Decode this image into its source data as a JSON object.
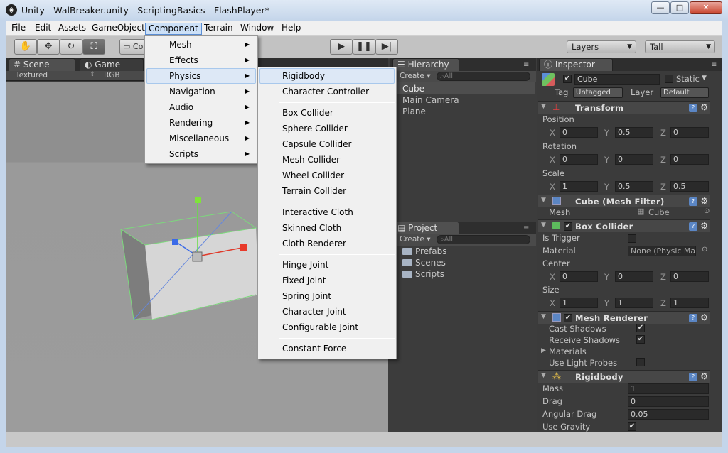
{
  "window": {
    "title": "Unity - WalBreaker.unity - ScriptingBasics - FlashPlayer*",
    "min": "—",
    "max": "□",
    "close": "✕"
  },
  "menubar": [
    "File",
    "Edit",
    "Assets",
    "GameObject",
    "Component",
    "Terrain",
    "Window",
    "Help"
  ],
  "toolbar": {
    "co_label": "Co",
    "layers": "Layers",
    "layout": "Tall"
  },
  "scene": {
    "tab_scene": "Scene",
    "tab_game": "Game",
    "shading": "Textured",
    "rgb": "RGB"
  },
  "component_menu": {
    "items": [
      "Mesh",
      "Effects",
      "Physics",
      "Navigation",
      "Audio",
      "Rendering",
      "Miscellaneous",
      "Scripts"
    ],
    "highlighted": "Physics"
  },
  "physics_menu": {
    "groups": [
      [
        "Rigidbody",
        "Character Controller"
      ],
      [
        "Box Collider",
        "Sphere Collider",
        "Capsule Collider",
        "Mesh Collider",
        "Wheel Collider",
        "Terrain Collider"
      ],
      [
        "Interactive Cloth",
        "Skinned Cloth",
        "Cloth Renderer"
      ],
      [
        "Hinge Joint",
        "Fixed Joint",
        "Spring Joint",
        "Character Joint",
        "Configurable Joint"
      ],
      [
        "Constant Force"
      ]
    ],
    "highlighted": "Rigidbody"
  },
  "hierarchy": {
    "tab": "Hierarchy",
    "create": "Create ▾",
    "search": "All",
    "items": [
      "Cube",
      "Main Camera",
      "Plane"
    ]
  },
  "project": {
    "tab": "Project",
    "create": "Create ▾",
    "search": "All",
    "items": [
      "Prefabs",
      "Scenes",
      "Scripts"
    ]
  },
  "inspector": {
    "tab": "Inspector",
    "object_name": "Cube",
    "static_label": "Static",
    "tag_label": "Tag",
    "tag_value": "Untagged",
    "layer_label": "Layer",
    "layer_value": "Default",
    "transform": {
      "title": "Transform",
      "position_label": "Position",
      "position": [
        "0",
        "0.5",
        "0"
      ],
      "rotation_label": "Rotation",
      "rotation": [
        "0",
        "0",
        "0"
      ],
      "scale_label": "Scale",
      "scale": [
        "1",
        "0.5",
        "0.5"
      ]
    },
    "axis": [
      "X",
      "Y",
      "Z"
    ],
    "mesh_filter": {
      "title": "Cube (Mesh Filter)",
      "mesh_label": "Mesh",
      "mesh_value": "Cube"
    },
    "box_collider": {
      "title": "Box Collider",
      "trigger_label": "Is Trigger",
      "material_label": "Material",
      "material_value": "None (Physic Ma",
      "center_label": "Center",
      "center": [
        "0",
        "0",
        "0"
      ],
      "size_label": "Size",
      "size": [
        "1",
        "1",
        "1"
      ]
    },
    "mesh_renderer": {
      "title": "Mesh Renderer",
      "cast": "Cast Shadows",
      "receive": "Receive Shadows",
      "materials": "Materials",
      "light_probes": "Use Light Probes"
    },
    "rigidbody": {
      "title": "Rigidbody",
      "mass_label": "Mass",
      "mass": "1",
      "drag_label": "Drag",
      "drag": "0",
      "angular_label": "Angular Drag",
      "angular": "0.05",
      "gravity_label": "Use Gravity"
    }
  }
}
